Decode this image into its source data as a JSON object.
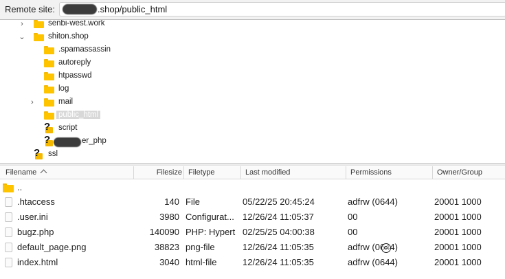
{
  "site_bar": {
    "label": "Remote site:",
    "path_suffix": ".shop/public_html"
  },
  "tree": [
    {
      "label": "senbi-west.work",
      "icon": "folder-icon",
      "expander": "chevron-right-icon"
    },
    {
      "label": "shiton.shop",
      "icon": "folder-icon",
      "expander": "chevron-down-icon"
    },
    {
      "label": ".spamassassin",
      "icon": "folder-icon"
    },
    {
      "label": "autoreply",
      "icon": "folder-icon"
    },
    {
      "label": "htpasswd",
      "icon": "folder-icon"
    },
    {
      "label": "log",
      "icon": "folder-icon"
    },
    {
      "label": "mail",
      "icon": "folder-icon",
      "expander": "chevron-right-icon"
    },
    {
      "label": "public_html",
      "icon": "folder-icon",
      "selected": true
    },
    {
      "label": "script",
      "icon": "unknown-folder-icon"
    },
    {
      "label": "er_php",
      "icon": "unknown-folder-icon",
      "redacted_prefix": true
    },
    {
      "label": "ssl",
      "icon": "unknown-folder-icon"
    }
  ],
  "columns": {
    "filename": "Filename",
    "filesize": "Filesize",
    "filetype": "Filetype",
    "modified": "Last modified",
    "permissions": "Permissions",
    "owner": "Owner/Group"
  },
  "parent_dir": "..",
  "files": [
    {
      "name": ".htaccess",
      "size": "140",
      "type": "File",
      "modified": "05/22/25 20:45:24",
      "perms": "adfrw (0644)",
      "owner": "20001 1000"
    },
    {
      "name": ".user.ini",
      "size": "3980",
      "type": "Configurat...",
      "modified": "12/26/24 11:05:37",
      "perms": "00",
      "owner": "20001 1000"
    },
    {
      "name": "bugz.php",
      "size": "140090",
      "type": "PHP: Hypert",
      "modified": "02/25/25 04:00:38",
      "perms": "00",
      "owner": "20001 1000"
    },
    {
      "name": "default_page.png",
      "size": "38823",
      "type": "png-file",
      "modified": "12/26/24 11:05:35",
      "perms": "adfrw (0644)",
      "owner": "20001 1000"
    },
    {
      "name": "index.html",
      "size": "3040",
      "type": "html-file",
      "modified": "12/26/24 11:05:35",
      "perms": "adfrw (0644)",
      "owner": "20001 1000"
    }
  ],
  "colors": {
    "folder": "#ffc400",
    "selection": "#d8d8d8",
    "header_bg": "#fafafa"
  }
}
